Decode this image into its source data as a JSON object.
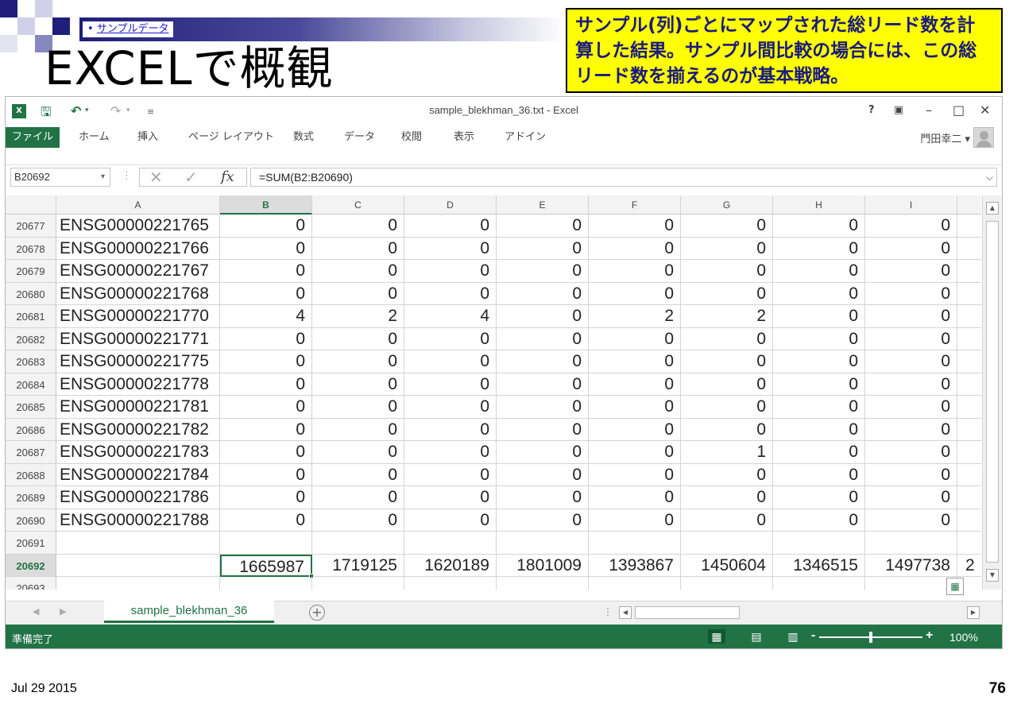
{
  "slide": {
    "bullet": "サンプルデータ",
    "title": "EXCELで概観",
    "callout": "サンプル(列)ごとにマップされた総リード数を計算した結果。サンプル間比較の場合には、この総リード数を揃えるのが基本戦略。",
    "date": "Jul 29 2015",
    "page": "76"
  },
  "window": {
    "title": "sample_blekhman_36.txt - Excel",
    "user": "門田幸二",
    "tabs": [
      "ファイル",
      "ホーム",
      "挿入",
      "ページ レイアウト",
      "数式",
      "データ",
      "校閲",
      "表示",
      "アドイン"
    ]
  },
  "formula_bar": {
    "name_box": "B20692",
    "formula": "=SUM(B2:B20690)"
  },
  "grid": {
    "columns": [
      "A",
      "B",
      "C",
      "D",
      "E",
      "F",
      "G",
      "H",
      "I"
    ],
    "rows": [
      {
        "n": "20677",
        "cells": [
          "ENSG00000221765",
          "0",
          "0",
          "0",
          "0",
          "0",
          "0",
          "0",
          "0"
        ]
      },
      {
        "n": "20678",
        "cells": [
          "ENSG00000221766",
          "0",
          "0",
          "0",
          "0",
          "0",
          "0",
          "0",
          "0"
        ]
      },
      {
        "n": "20679",
        "cells": [
          "ENSG00000221767",
          "0",
          "0",
          "0",
          "0",
          "0",
          "0",
          "0",
          "0"
        ]
      },
      {
        "n": "20680",
        "cells": [
          "ENSG00000221768",
          "0",
          "0",
          "0",
          "0",
          "0",
          "0",
          "0",
          "0"
        ]
      },
      {
        "n": "20681",
        "cells": [
          "ENSG00000221770",
          "4",
          "2",
          "4",
          "0",
          "2",
          "2",
          "0",
          "0"
        ]
      },
      {
        "n": "20682",
        "cells": [
          "ENSG00000221771",
          "0",
          "0",
          "0",
          "0",
          "0",
          "0",
          "0",
          "0"
        ]
      },
      {
        "n": "20683",
        "cells": [
          "ENSG00000221775",
          "0",
          "0",
          "0",
          "0",
          "0",
          "0",
          "0",
          "0"
        ]
      },
      {
        "n": "20684",
        "cells": [
          "ENSG00000221778",
          "0",
          "0",
          "0",
          "0",
          "0",
          "0",
          "0",
          "0"
        ]
      },
      {
        "n": "20685",
        "cells": [
          "ENSG00000221781",
          "0",
          "0",
          "0",
          "0",
          "0",
          "0",
          "0",
          "0"
        ]
      },
      {
        "n": "20686",
        "cells": [
          "ENSG00000221782",
          "0",
          "0",
          "0",
          "0",
          "0",
          "0",
          "0",
          "0"
        ]
      },
      {
        "n": "20687",
        "cells": [
          "ENSG00000221783",
          "0",
          "0",
          "0",
          "0",
          "0",
          "1",
          "0",
          "0"
        ]
      },
      {
        "n": "20688",
        "cells": [
          "ENSG00000221784",
          "0",
          "0",
          "0",
          "0",
          "0",
          "0",
          "0",
          "0"
        ]
      },
      {
        "n": "20689",
        "cells": [
          "ENSG00000221786",
          "0",
          "0",
          "0",
          "0",
          "0",
          "0",
          "0",
          "0"
        ]
      },
      {
        "n": "20690",
        "cells": [
          "ENSG00000221788",
          "0",
          "0",
          "0",
          "0",
          "0",
          "0",
          "0",
          "0"
        ]
      },
      {
        "n": "20691",
        "cells": [
          "",
          "",
          "",
          "",
          "",
          "",
          "",
          "",
          ""
        ]
      },
      {
        "n": "20692",
        "cells": [
          "",
          "1665987",
          "1719125",
          "1620189",
          "1801009",
          "1393867",
          "1450604",
          "1346515",
          "1497738"
        ],
        "overflow": "2"
      },
      {
        "n": "20693",
        "cells": [
          "",
          "",
          "",
          "",
          "",
          "",
          "",
          "",
          ""
        ]
      }
    ]
  },
  "sheet_tab": "sample_blekhman_36",
  "status": {
    "text": "準備完了",
    "zoom": "100%",
    "zoom_fraction": 0.5
  },
  "colors": {
    "excel_green": "#217346",
    "callout_bg": "#ffff00"
  }
}
